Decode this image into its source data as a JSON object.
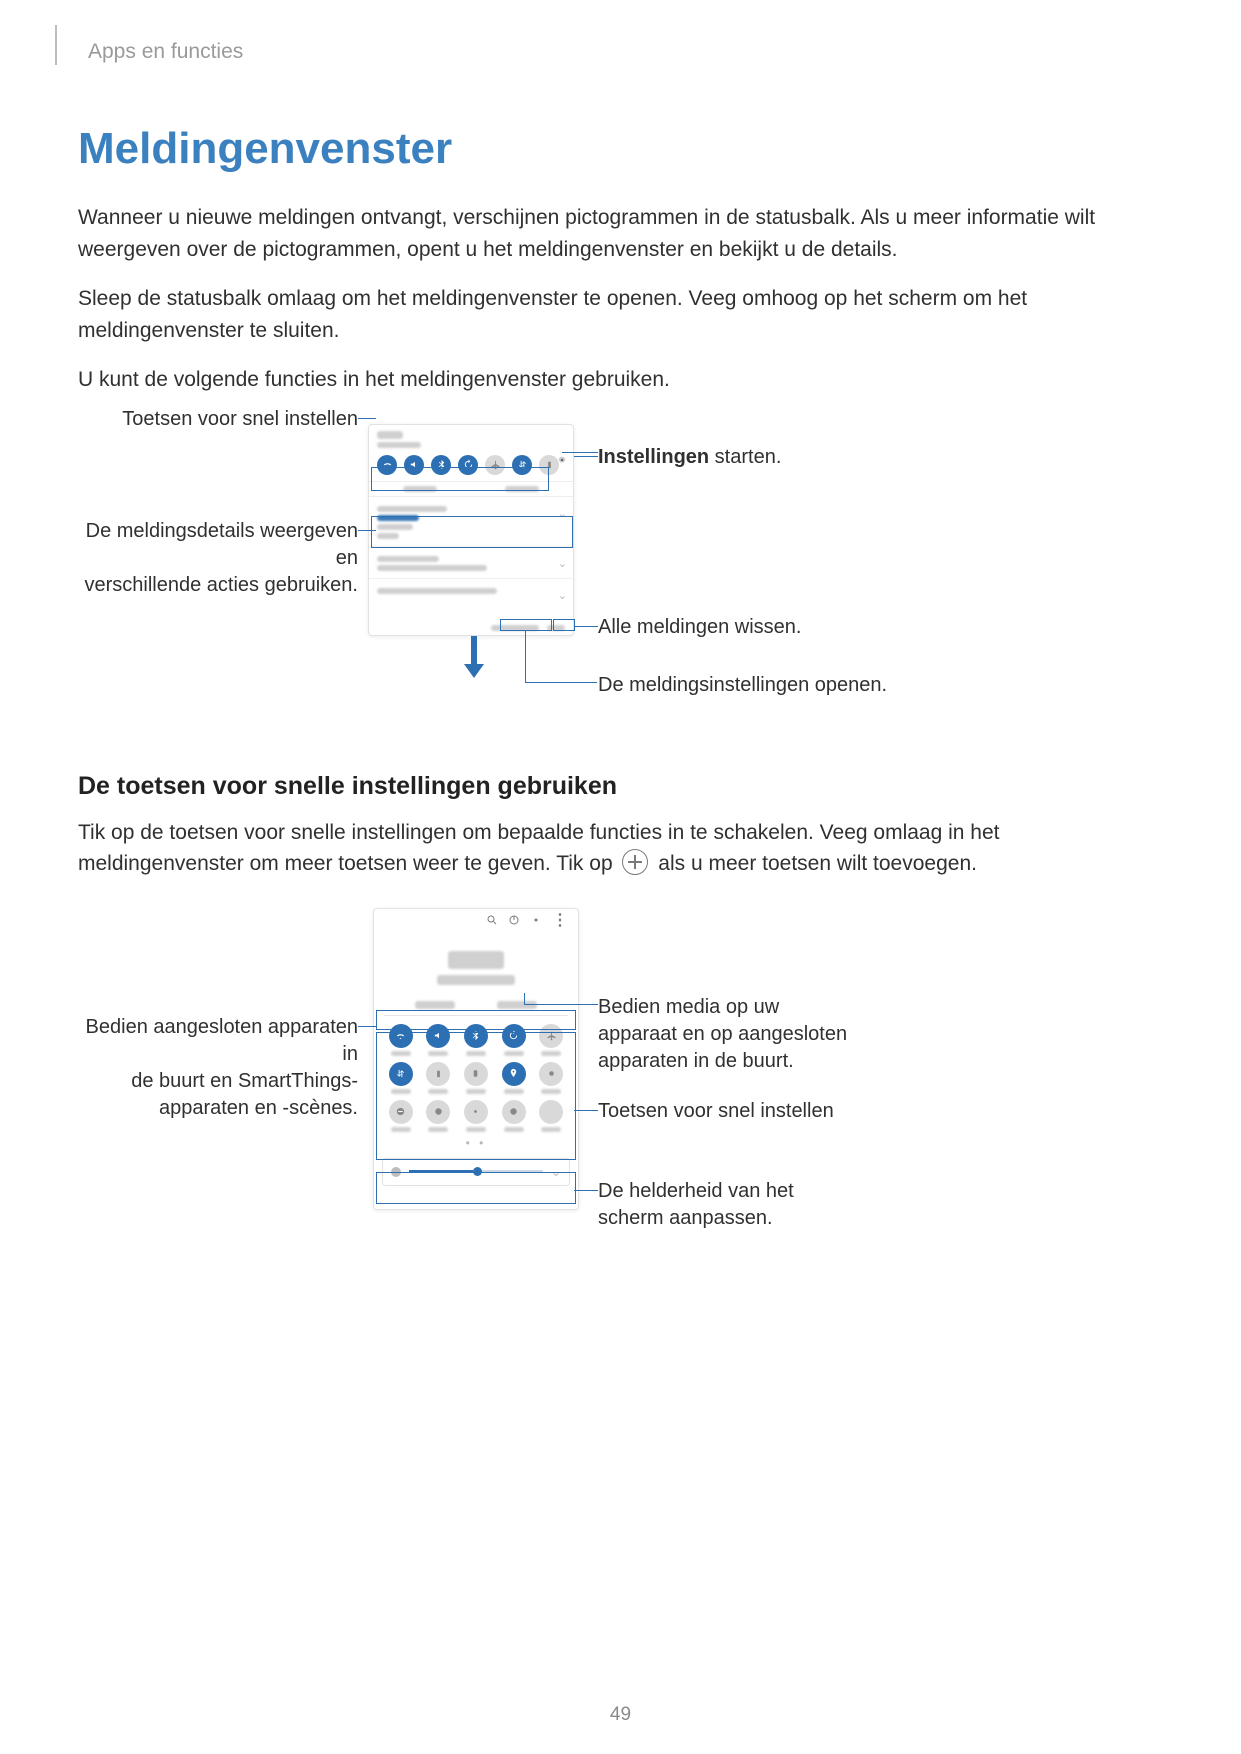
{
  "header": "Apps en functies",
  "title": "Meldingenvenster",
  "para1": "Wanneer u nieuwe meldingen ontvangt, verschijnen pictogrammen in de statusbalk. Als u meer informatie wilt weergeven over de pictogrammen, opent u het meldingenvenster en bekijkt u de details.",
  "para2": "Sleep de statusbalk omlaag om het meldingenvenster te openen. Veeg omhoog op het scherm om het meldingenvenster te sluiten.",
  "para3": "U kunt de volgende functies in het meldingenvenster gebruiken.",
  "fig1": {
    "left1": "Toetsen voor snel instellen",
    "left2a": "De meldingsdetails weergeven en",
    "left2b": "verschillende acties gebruiken.",
    "right1_strong": "Instellingen",
    "right1_rest": " starten.",
    "right2": "Alle meldingen wissen.",
    "right3": "De meldingsinstellingen openen."
  },
  "subheading": "De toetsen voor snelle instellingen gebruiken",
  "para4a": "Tik op de toetsen voor snelle instellingen om bepaalde functies in te schakelen. Veeg omlaag in het meldingenvenster om meer toetsen weer te geven. Tik op ",
  "para4b": " als u meer toetsen wilt toevoegen.",
  "fig2": {
    "left1a": "Bedien aangesloten apparaten in",
    "left1b": "de buurt en SmartThings-",
    "left1c": "apparaten en -scènes.",
    "right1": "Bedien media op uw apparaat en op aangesloten apparaten in de buurt.",
    "right2": "Toetsen voor snel instellen",
    "right3": "De helderheid van het scherm aanpassen."
  },
  "page_number": "49"
}
